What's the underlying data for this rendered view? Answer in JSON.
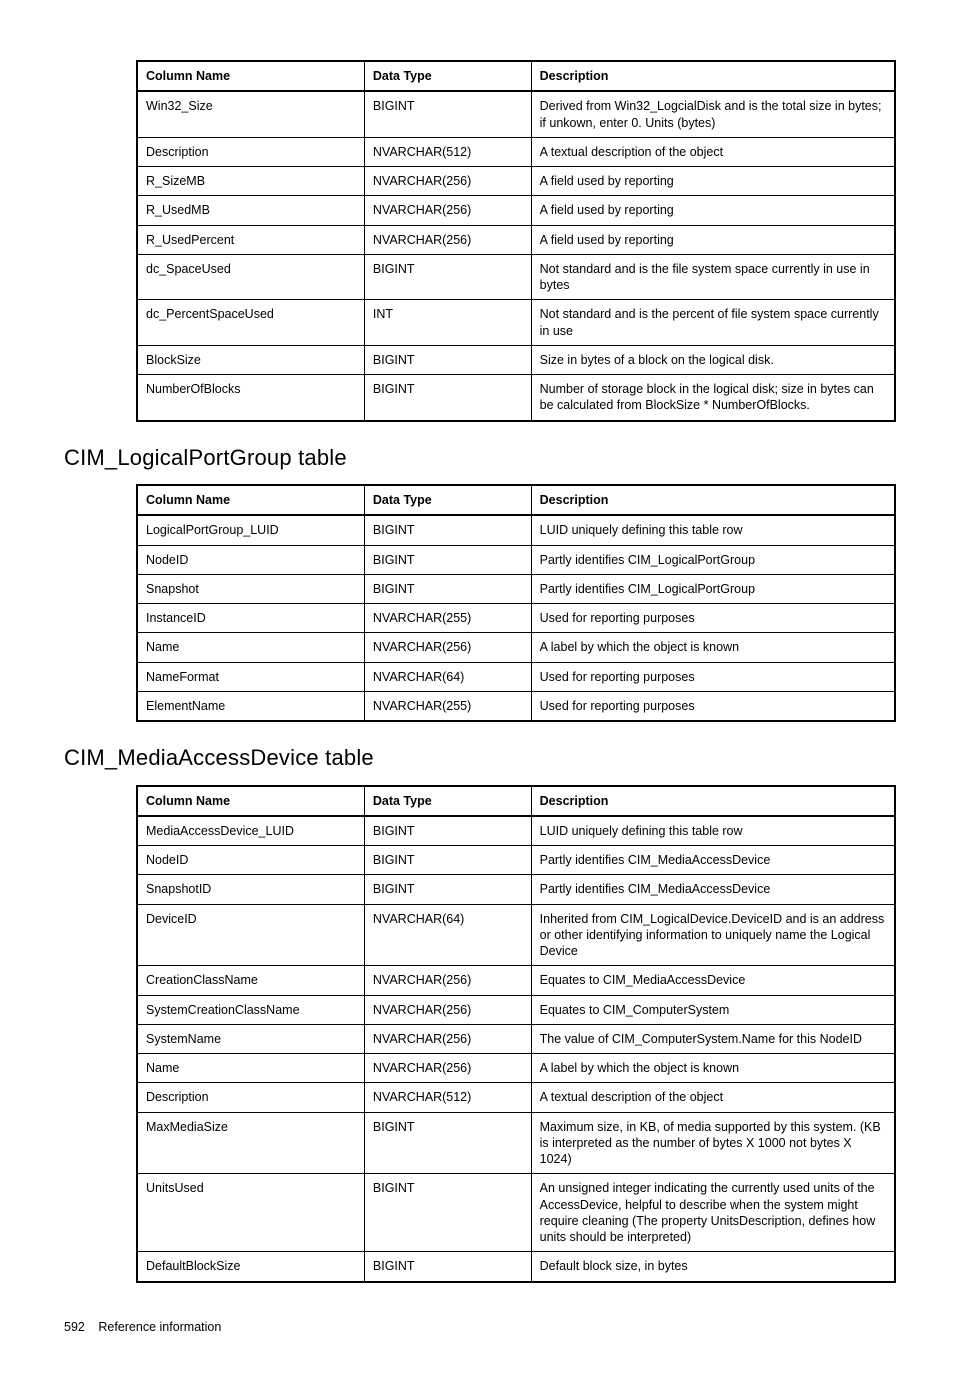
{
  "headers": {
    "col": "Column Name",
    "type": "Data Type",
    "desc": "Description"
  },
  "table1": {
    "rows": [
      {
        "col": "Win32_Size",
        "type": "BIGINT",
        "desc": "Derived from Win32_LogcialDisk and is the total size in bytes; if unkown, enter 0. Units (bytes)"
      },
      {
        "col": "Description",
        "type": "NVARCHAR(512)",
        "desc": "A textual description of the object"
      },
      {
        "col": "R_SizeMB",
        "type": "NVARCHAR(256)",
        "desc": "A field used by reporting"
      },
      {
        "col": "R_UsedMB",
        "type": "NVARCHAR(256)",
        "desc": "A field used by reporting"
      },
      {
        "col": "R_UsedPercent",
        "type": "NVARCHAR(256)",
        "desc": "A field used by reporting"
      },
      {
        "col": "dc_SpaceUsed",
        "type": "BIGINT",
        "desc": "Not standard and is the file system space currently in use in bytes"
      },
      {
        "col": "dc_PercentSpaceUsed",
        "type": "INT",
        "desc": "Not standard and is the percent of file system space currently in use"
      },
      {
        "col": "BlockSize",
        "type": "BIGINT",
        "desc": "Size in bytes of a block on the logical disk."
      },
      {
        "col": "NumberOfBlocks",
        "type": "BIGINT",
        "desc": "Number of storage block in the logical disk; size in bytes can be calculated from BlockSize * NumberOfBlocks."
      }
    ]
  },
  "table2": {
    "title": "CIM_LogicalPortGroup table",
    "rows": [
      {
        "col": "LogicalPortGroup_LUID",
        "type": "BIGINT",
        "desc": "LUID uniquely defining this table row"
      },
      {
        "col": "NodeID",
        "type": "BIGINT",
        "desc": "Partly identifies CIM_LogicalPortGroup"
      },
      {
        "col": "Snapshot",
        "type": "BIGINT",
        "desc": "Partly identifies CIM_LogicalPortGroup"
      },
      {
        "col": "InstanceID",
        "type": "NVARCHAR(255)",
        "desc": "Used for reporting purposes"
      },
      {
        "col": "Name",
        "type": "NVARCHAR(256)",
        "desc": "A label by which the object is known"
      },
      {
        "col": "NameFormat",
        "type": "NVARCHAR(64)",
        "desc": "Used for reporting purposes"
      },
      {
        "col": "ElementName",
        "type": "NVARCHAR(255)",
        "desc": "Used for reporting purposes"
      }
    ]
  },
  "table3": {
    "title": "CIM_MediaAccessDevice table",
    "rows": [
      {
        "col": "MediaAccessDevice_LUID",
        "type": "BIGINT",
        "desc": "LUID uniquely defining this table row"
      },
      {
        "col": "NodeID",
        "type": "BIGINT",
        "desc": "Partly identifies CIM_MediaAccessDevice"
      },
      {
        "col": "SnapshotID",
        "type": "BIGINT",
        "desc": "Partly identifies CIM_MediaAccessDevice"
      },
      {
        "col": "DeviceID",
        "type": "NVARCHAR(64)",
        "desc": "Inherited from CIM_LogicalDevice.DeviceID and is an address or other identifying information to uniquely name the Logical Device"
      },
      {
        "col": "CreationClassName",
        "type": "NVARCHAR(256)",
        "desc": "Equates to CIM_MediaAccessDevice"
      },
      {
        "col": "SystemCreationClassName",
        "type": "NVARCHAR(256)",
        "desc": "Equates to CIM_ComputerSystem"
      },
      {
        "col": "SystemName",
        "type": "NVARCHAR(256)",
        "desc": "The value of CIM_ComputerSystem.Name for this NodeID"
      },
      {
        "col": "Name",
        "type": "NVARCHAR(256)",
        "desc": "A label by which the object is known"
      },
      {
        "col": "Description",
        "type": "NVARCHAR(512)",
        "desc": "A textual description of the object"
      },
      {
        "col": "MaxMediaSize",
        "type": "BIGINT",
        "desc": "Maximum size, in KB, of media supported by this system. (KB is interpreted as the number of bytes X 1000 not bytes X 1024)"
      },
      {
        "col": "UnitsUsed",
        "type": "BIGINT",
        "desc": "An unsigned integer indicating the currently used units of the AccessDevice, helpful to describe when the system might require cleaning (The property UnitsDescription, defines how units should be interpreted)"
      },
      {
        "col": "DefaultBlockSize",
        "type": "BIGINT",
        "desc": "Default block size, in bytes"
      }
    ]
  },
  "footer": {
    "page": "592",
    "section": "Reference information"
  }
}
